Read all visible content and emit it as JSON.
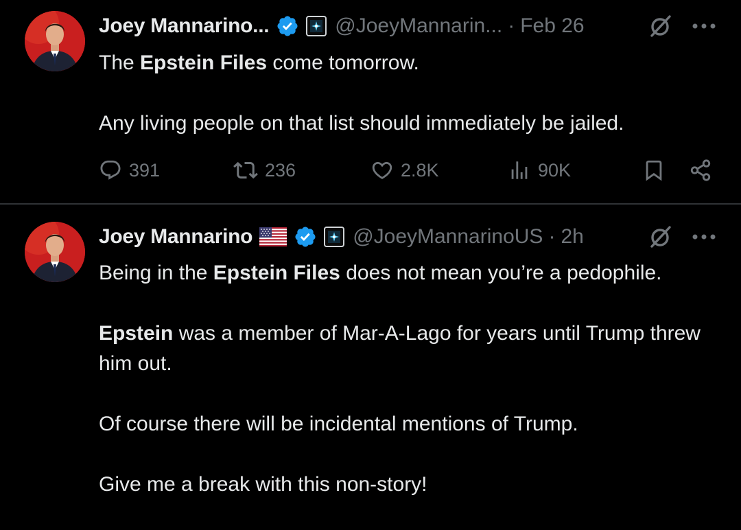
{
  "tweets": [
    {
      "author": "Joey Mannarino...",
      "handle": "@JoeyMannarin...",
      "separator": "·",
      "time": "Feb 26",
      "body": {
        "p1_before": "The ",
        "p1_bold": "Epstein Files",
        "p1_after": " come tomorrow.",
        "p2": "Any living people on that list should immediately be jailed."
      },
      "stats": {
        "replies": "391",
        "reposts": "236",
        "likes": "2.8K",
        "views": "90K"
      }
    },
    {
      "author": "Joey Mannarino",
      "handle": "@JoeyMannarinoUS",
      "separator": "·",
      "time": "2h",
      "body": {
        "p1_before": "Being in the ",
        "p1_bold": "Epstein Files",
        "p1_after": " does not mean you’re a pedophile.",
        "p2_bold": "Epstein",
        "p2_after": " was a member of Mar-A-Lago for years until Trump threw him out.",
        "p3": "Of course there will be incidental mentions of Trump.",
        "p4": "Give me a break with this non-story!"
      }
    }
  ],
  "icons": {
    "verified": "verified-badge-icon",
    "affiliate": "affiliate-badge-icon",
    "flag": "us-flag-icon",
    "grok": "grok-icon",
    "more": "more-icon",
    "reply": "reply-icon",
    "repost": "repost-icon",
    "like": "heart-icon",
    "views": "views-icon",
    "bookmark": "bookmark-icon",
    "share": "share-icon"
  },
  "colors": {
    "background": "#000000",
    "text": "#e7e9ea",
    "secondary": "#71767b",
    "verified": "#1d9bf0",
    "divider": "#2f3336"
  }
}
